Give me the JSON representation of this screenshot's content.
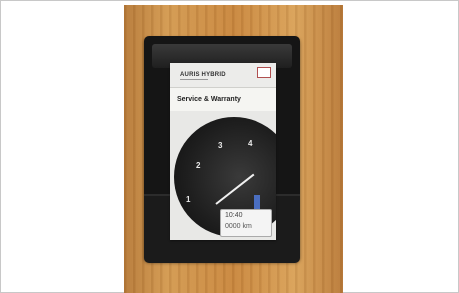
{
  "photo": {
    "description_free": true,
    "booklet": {
      "model": "AURIS HYBRID",
      "title": "Service & Warranty"
    },
    "dial_numbers": [
      "1",
      "2",
      "3",
      "4"
    ],
    "odometer": {
      "time": "10:40",
      "reading": "0000 km"
    }
  }
}
